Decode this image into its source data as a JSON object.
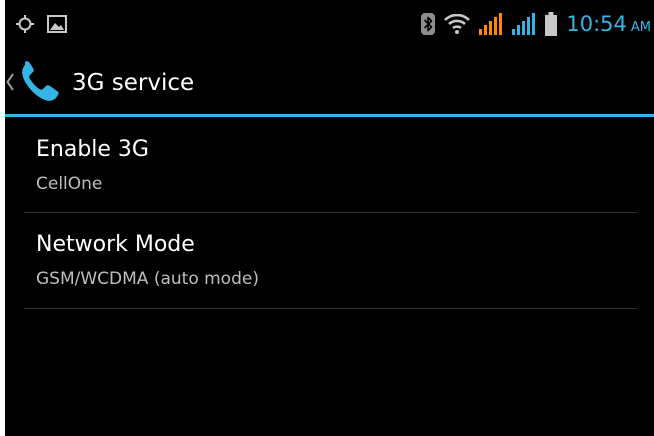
{
  "status_bar": {
    "left_icons": [
      "location-icon",
      "picture-icon"
    ],
    "right_icons": [
      "bluetooth-icon",
      "wifi-icon",
      "signal-icon-sim1",
      "signal-icon-sim2",
      "battery-icon"
    ],
    "time": "10:54",
    "ampm": "AM",
    "colors": {
      "accent": "#33b5e5",
      "signal_sim1": "#ff8a00",
      "signal_sim2": "#33b5e5",
      "icon_grey": "#c8c8c8"
    }
  },
  "action_bar": {
    "up_icon": "chevron-left-icon",
    "app_icon": "phone-icon",
    "title": "3G service"
  },
  "preferences": [
    {
      "title": "Enable 3G",
      "summary": "CellOne"
    },
    {
      "title": "Network Mode",
      "summary": "GSM/WCDMA (auto mode)"
    }
  ]
}
